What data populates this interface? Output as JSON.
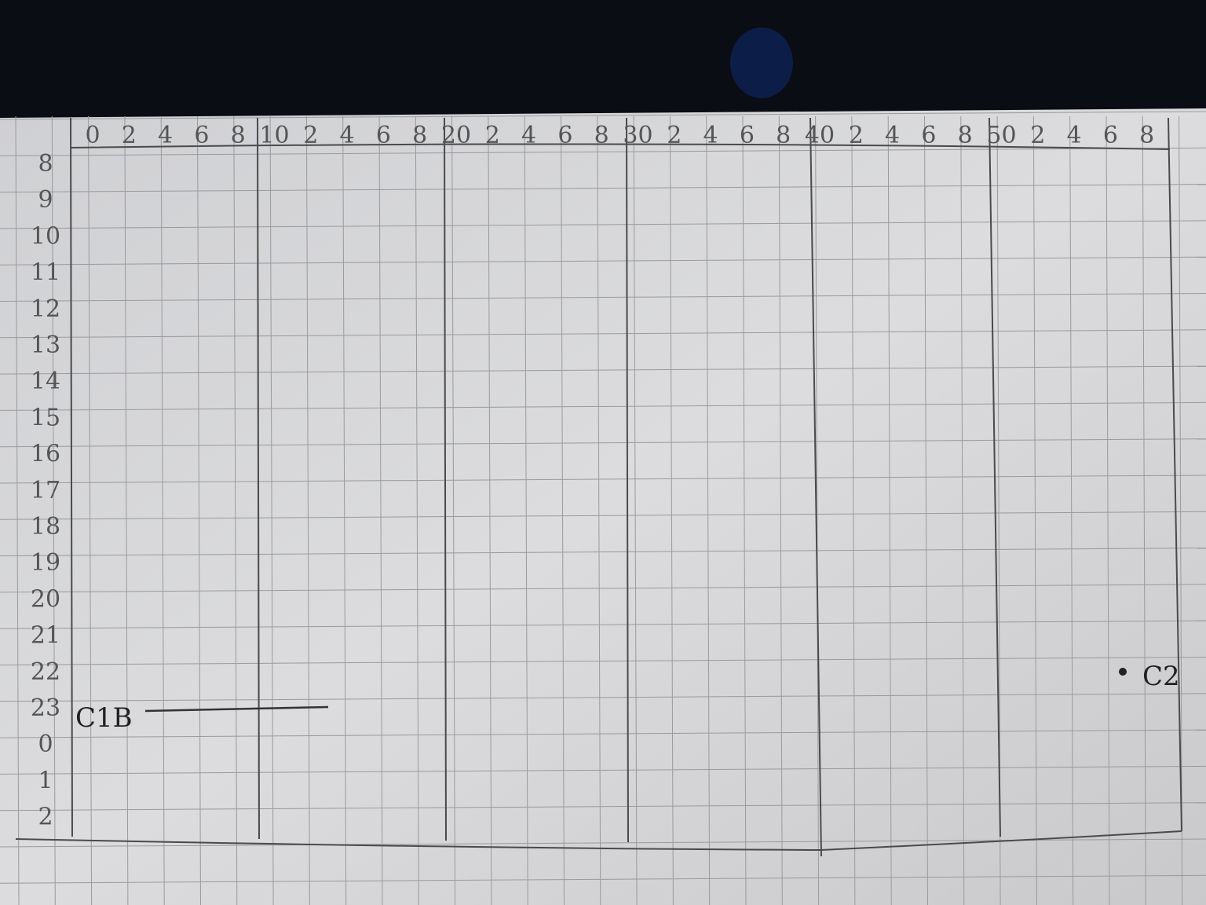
{
  "header_labels": [
    "0",
    "2",
    "4",
    "6",
    "8",
    "10",
    "2",
    "4",
    "6",
    "8",
    "20",
    "2",
    "4",
    "6",
    "8",
    "30",
    "2",
    "4",
    "6",
    "8",
    "40",
    "2",
    "4",
    "6",
    "8",
    "50",
    "2",
    "4",
    "6",
    "8"
  ],
  "row_labels": [
    "8",
    "9",
    "10",
    "11",
    "12",
    "13",
    "14",
    "15",
    "16",
    "17",
    "18",
    "19",
    "20",
    "21",
    "22",
    "23",
    "0",
    "1",
    "2"
  ],
  "annotations": {
    "left_mark": "C1B",
    "right_mark": "C2"
  },
  "colors": {
    "paper": "#d9d9db",
    "grid": "#9a9a9e",
    "pencil": "#4a4a4a",
    "background": "#0b0d14"
  }
}
